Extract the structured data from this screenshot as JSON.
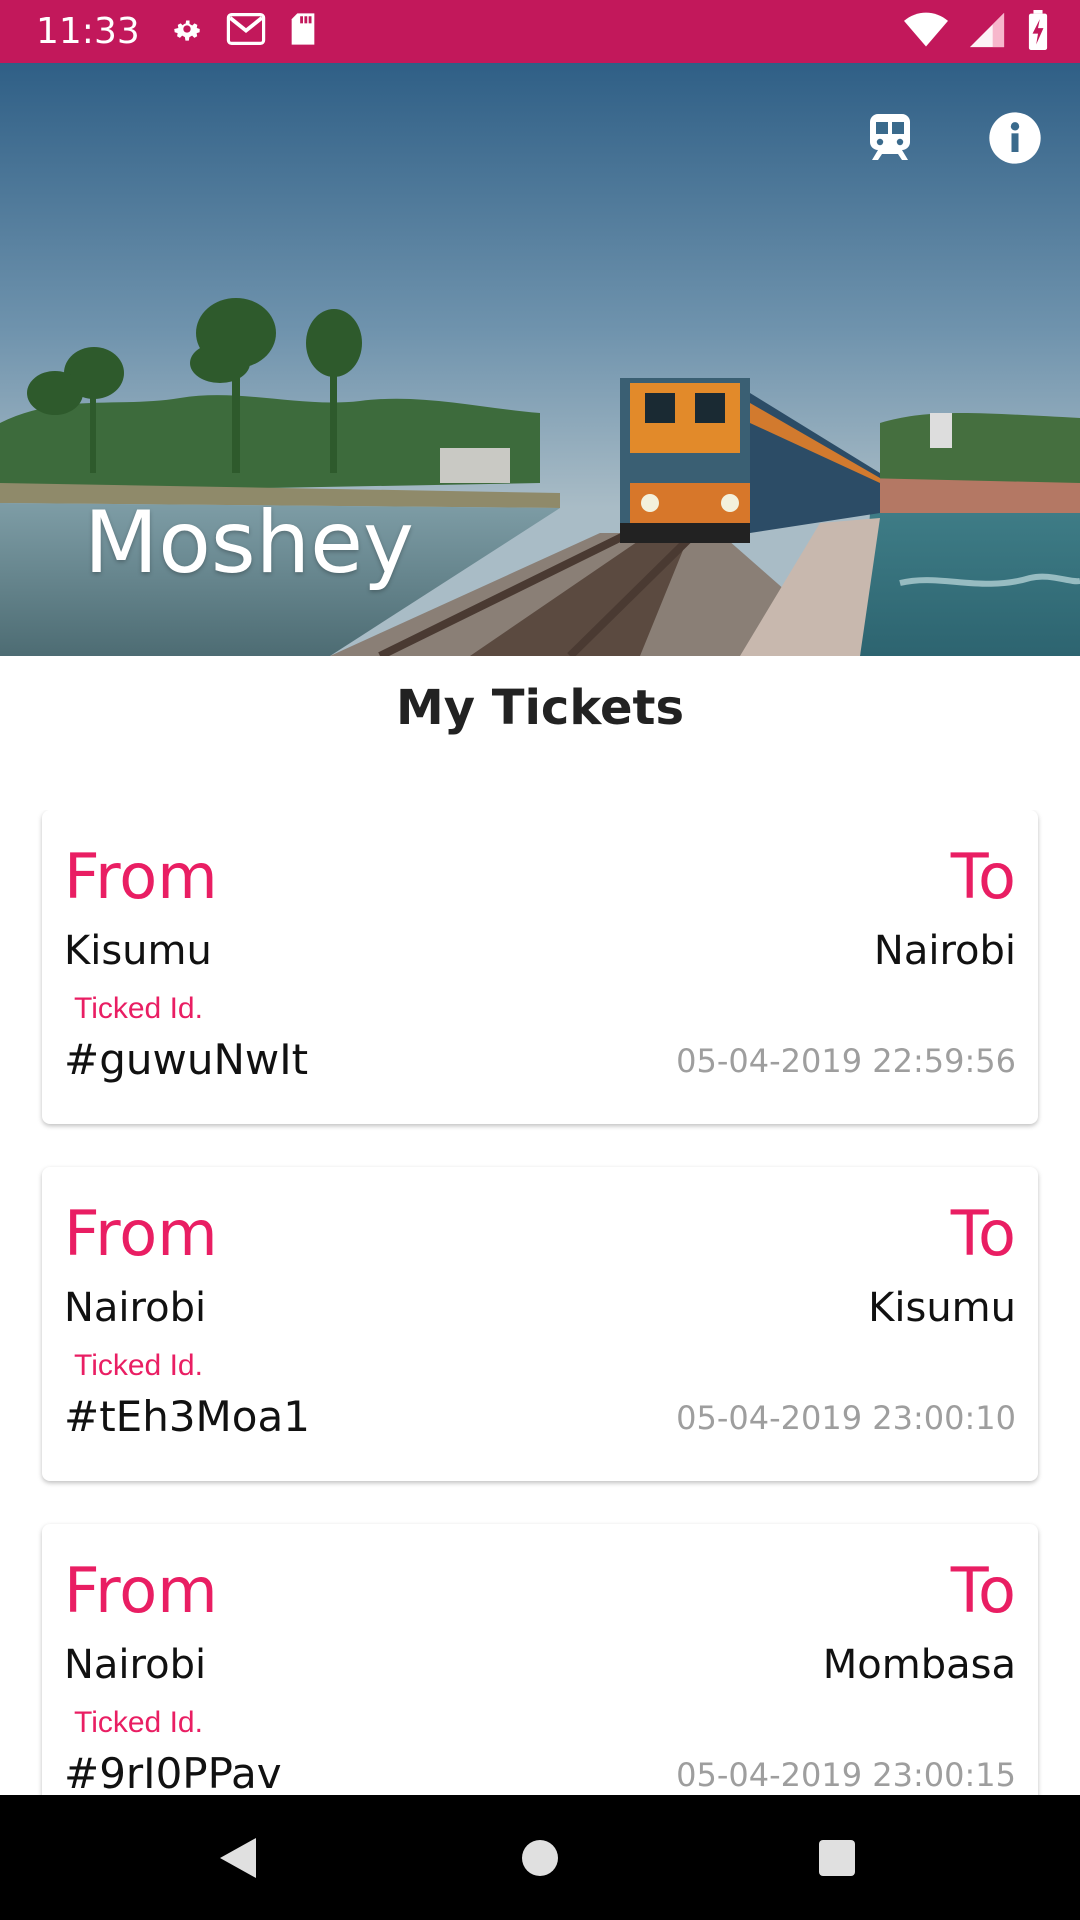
{
  "status_bar": {
    "time": "11:33",
    "left_icons": [
      "gear-icon",
      "gmail-icon",
      "sd-card-icon"
    ],
    "right_icons": [
      "wifi-icon",
      "cell-signal-icon",
      "battery-charging-icon"
    ]
  },
  "header": {
    "user_name": "Moshey",
    "actions": [
      "train-icon",
      "info-icon"
    ]
  },
  "section_title": "My Tickets",
  "tickets": [
    {
      "from_label": "From",
      "to_label": "To",
      "from_city": "Kisumu",
      "to_city": "Nairobi",
      "ticket_id_label": "Ticked Id.",
      "ticket_id": "#guwuNwIt",
      "timestamp": "05-04-2019 22:59:56"
    },
    {
      "from_label": "From",
      "to_label": "To",
      "from_city": "Nairobi",
      "to_city": "Kisumu",
      "ticket_id_label": "Ticked Id.",
      "ticket_id": "#tEh3Moa1",
      "timestamp": "05-04-2019 23:00:10"
    },
    {
      "from_label": "From",
      "to_label": "To",
      "from_city": "Nairobi",
      "to_city": "Mombasa",
      "ticket_id_label": "Ticked Id.",
      "ticket_id": "#9rI0PPav",
      "timestamp": "05-04-2019 23:00:15"
    }
  ],
  "nav_bar": [
    "back-icon",
    "home-icon",
    "recents-icon"
  ],
  "colors": {
    "status_bar": "#c2185b",
    "accent": "#e91e63",
    "timestamp": "#9e9e9e"
  }
}
